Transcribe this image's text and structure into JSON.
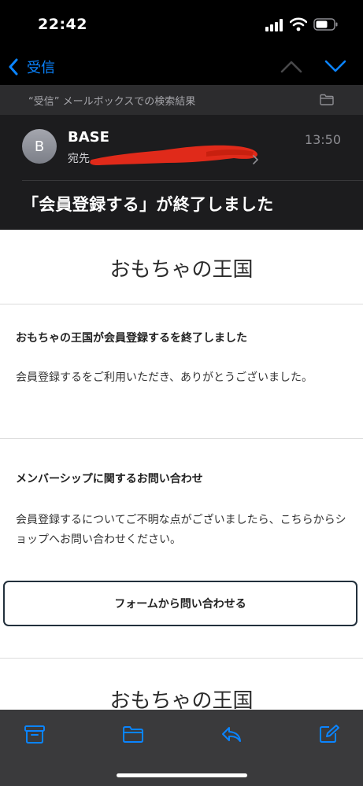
{
  "status_bar": {
    "time": "22:42"
  },
  "nav": {
    "back_label": "受信"
  },
  "search_context": {
    "text": "“受信” メールボックスでの検索結果"
  },
  "header": {
    "avatar_initial": "B",
    "sender": "BASE",
    "time": "13:50",
    "to_label": "宛先",
    "subject": "「会員登録する」が終了しました"
  },
  "email": {
    "shop_name": "おもちゃの王国",
    "section1_heading": "おもちゃの王国が会員登録するを終了しました",
    "section1_body": "会員登録するをご利用いただき、ありがとうございました。",
    "section2_heading": "メンバーシップに関するお問い合わせ",
    "section2_body": "会員登録するについてご不明な点がございましたら、こちらからショップへお問い合わせください。",
    "contact_button": "フォームから問い合わせる",
    "footer_shop_name": "おもちゃの王国"
  },
  "toolbar": {
    "icons": [
      "archive-icon",
      "folder-icon",
      "reply-icon",
      "compose-icon"
    ]
  },
  "colors": {
    "accent": "#0a84ff",
    "redaction": "#e02a1a"
  }
}
